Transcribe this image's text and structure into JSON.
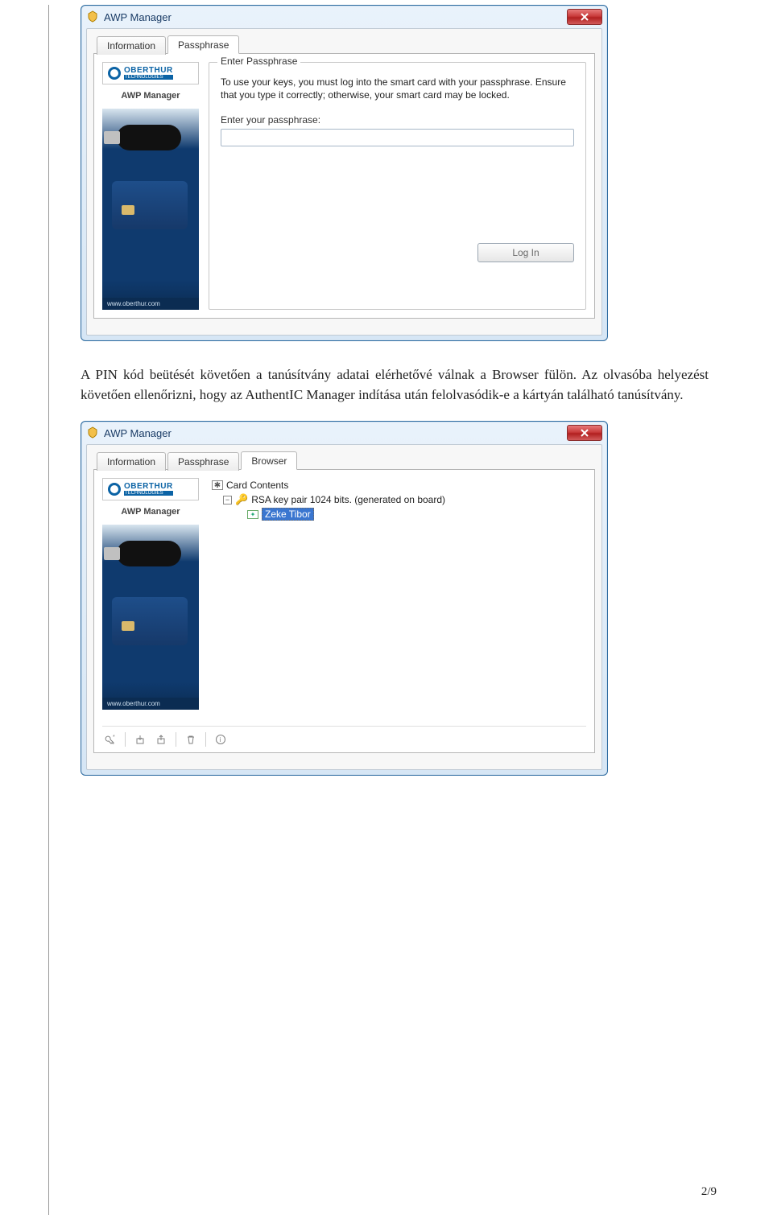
{
  "page_number": "2/9",
  "paragraph": "A PIN kód beütését követően a tanúsítvány adatai elérhetővé válnak a Browser fülön. Az olvasóba helyezést követően ellenőrizni, hogy az AuthentIC Manager indítása után felolvasódik-e a kártyán található tanúsítvány.",
  "win1": {
    "title": "AWP Manager",
    "tabs": {
      "information": "Information",
      "passphrase": "Passphrase"
    },
    "sidebar": {
      "brand": "OBERTHUR",
      "brand_sub": "TECHNOLOGIES",
      "product": "AWP Manager",
      "url": "www.oberthur.com"
    },
    "panel": {
      "legend": "Enter Passphrase",
      "instructions": "To use your keys, you must log into the smart card with your passphrase. Ensure that you type it correctly; otherwise, your smart card may be locked.",
      "input_label": "Enter your passphrase:",
      "input_value": "",
      "login": "Log In"
    }
  },
  "win2": {
    "title": "AWP Manager",
    "tabs": {
      "information": "Information",
      "passphrase": "Passphrase",
      "browser": "Browser"
    },
    "sidebar": {
      "brand": "OBERTHUR",
      "brand_sub": "TECHNOLOGIES",
      "product": "AWP Manager",
      "url": "www.oberthur.com"
    },
    "tree": {
      "root": "Card Contents",
      "keypair": "RSA key pair 1024 bits. (generated on board)",
      "cert": "Zeke Tibor"
    }
  }
}
